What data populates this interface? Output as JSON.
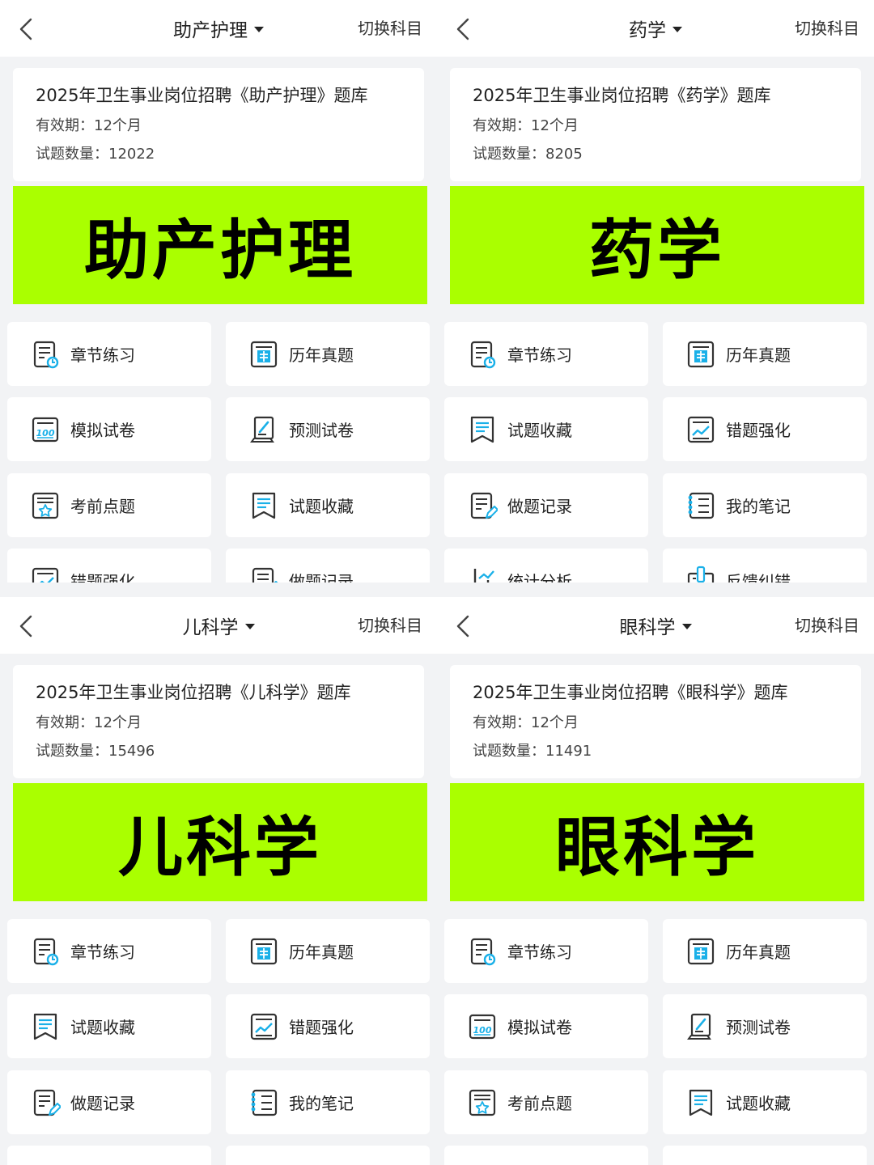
{
  "panels": [
    {
      "subject_title": "助产护理",
      "switch_label": "切换科目",
      "bank_title": "2025年卫生事业岗位招聘《助产护理》题库",
      "validity": "有效期：12个月",
      "question_count": "试题数量：12022",
      "banner_text": "助产护理",
      "tiles": [
        {
          "label": "章节练习",
          "icon": "chapter-practice-icon"
        },
        {
          "label": "历年真题",
          "icon": "past-exams-icon"
        },
        {
          "label": "模拟试卷",
          "icon": "mock-paper-icon"
        },
        {
          "label": "预测试卷",
          "icon": "forecast-paper-icon"
        },
        {
          "label": "考前点题",
          "icon": "pre-exam-tips-icon"
        },
        {
          "label": "试题收藏",
          "icon": "bookmark-icon"
        },
        {
          "label": "错题强化",
          "icon": "wrong-review-icon"
        },
        {
          "label": "做题记录",
          "icon": "record-icon"
        }
      ]
    },
    {
      "subject_title": "药学",
      "switch_label": "切换科目",
      "bank_title": "2025年卫生事业岗位招聘《药学》题库",
      "validity": "有效期：12个月",
      "question_count": "试题数量：8205",
      "banner_text": "药学",
      "tiles": [
        {
          "label": "章节练习",
          "icon": "chapter-practice-icon"
        },
        {
          "label": "历年真题",
          "icon": "past-exams-icon"
        },
        {
          "label": "试题收藏",
          "icon": "bookmark-icon"
        },
        {
          "label": "错题强化",
          "icon": "wrong-review-icon"
        },
        {
          "label": "做题记录",
          "icon": "record-icon"
        },
        {
          "label": "我的笔记",
          "icon": "notes-icon"
        },
        {
          "label": "统计分析",
          "icon": "stats-icon"
        },
        {
          "label": "反馈纠错",
          "icon": "feedback-icon"
        }
      ]
    },
    {
      "subject_title": "儿科学",
      "switch_label": "切换科目",
      "bank_title": "2025年卫生事业岗位招聘《儿科学》题库",
      "validity": "有效期：12个月",
      "question_count": "试题数量：15496",
      "banner_text": "儿科学",
      "tiles": [
        {
          "label": "章节练习",
          "icon": "chapter-practice-icon"
        },
        {
          "label": "历年真题",
          "icon": "past-exams-icon"
        },
        {
          "label": "试题收藏",
          "icon": "bookmark-icon"
        },
        {
          "label": "错题强化",
          "icon": "wrong-review-icon"
        },
        {
          "label": "做题记录",
          "icon": "record-icon"
        },
        {
          "label": "我的笔记",
          "icon": "notes-icon"
        }
      ]
    },
    {
      "subject_title": "眼科学",
      "switch_label": "切换科目",
      "bank_title": "2025年卫生事业岗位招聘《眼科学》题库",
      "validity": "有效期：12个月",
      "question_count": "试题数量：11491",
      "banner_text": "眼科学",
      "tiles": [
        {
          "label": "章节练习",
          "icon": "chapter-practice-icon"
        },
        {
          "label": "历年真题",
          "icon": "past-exams-icon"
        },
        {
          "label": "模拟试卷",
          "icon": "mock-paper-icon"
        },
        {
          "label": "预测试卷",
          "icon": "forecast-paper-icon"
        },
        {
          "label": "考前点题",
          "icon": "pre-exam-tips-icon"
        },
        {
          "label": "试题收藏",
          "icon": "bookmark-icon"
        }
      ]
    }
  ],
  "colors": {
    "banner": "#aaff00",
    "icon_stroke": "#333333",
    "icon_accent": "#1ab0e8",
    "page_bg": "#f2f3f5"
  }
}
